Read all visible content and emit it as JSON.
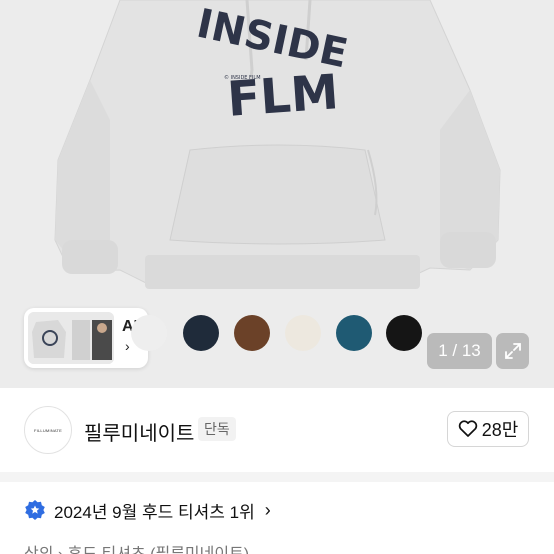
{
  "product": {
    "print_text_top": "INSIDE",
    "print_text_bottom": "FLM",
    "print_small": "© INSIDE FILM"
  },
  "gallery": {
    "ai_label": "AI",
    "ai_chevron": "›",
    "counter": "1 / 13",
    "swatches": [
      "#eeeeee",
      "#1f2b3a",
      "#6b4128",
      "#ede8df",
      "#1f5a73",
      "#151515"
    ]
  },
  "seller": {
    "logo_text": "FILLUMINATE",
    "name": "필루미네이트",
    "badge": "단독",
    "likes": "28만"
  },
  "ranking": {
    "text": "2024년 9월 후드 티셔츠 1위",
    "chevron": "›"
  },
  "breadcrumb": {
    "text": "상의 › 후드 티셔츠 (필루미네이트)"
  }
}
